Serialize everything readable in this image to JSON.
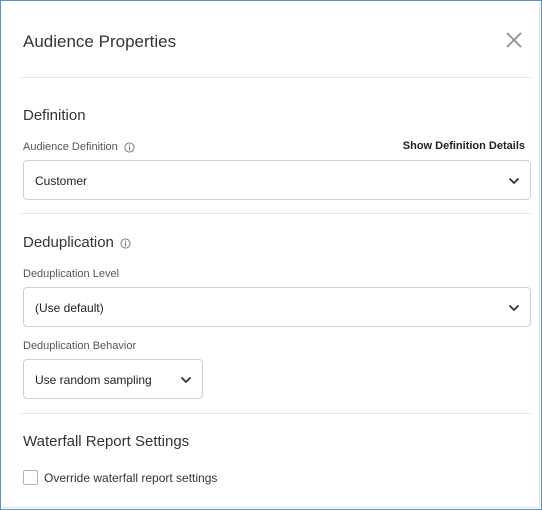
{
  "dialog": {
    "title": "Audience Properties",
    "close_icon": "close-icon"
  },
  "definition": {
    "section_title": "Definition",
    "audience_label": "Audience Definition",
    "show_details_link": "Show Definition Details",
    "audience_value": "Customer"
  },
  "deduplication": {
    "section_title": "Deduplication",
    "level_label": "Deduplication Level",
    "level_value": "(Use default)",
    "behavior_label": "Deduplication Behavior",
    "behavior_value": "Use random sampling"
  },
  "waterfall": {
    "section_title": "Waterfall Report Settings",
    "override_label": "Override waterfall report settings",
    "override_checked": false
  },
  "colors": {
    "frame_border": "#5a8fc8",
    "divider": "#e6e6e6",
    "field_border": "#cfcfcf"
  }
}
